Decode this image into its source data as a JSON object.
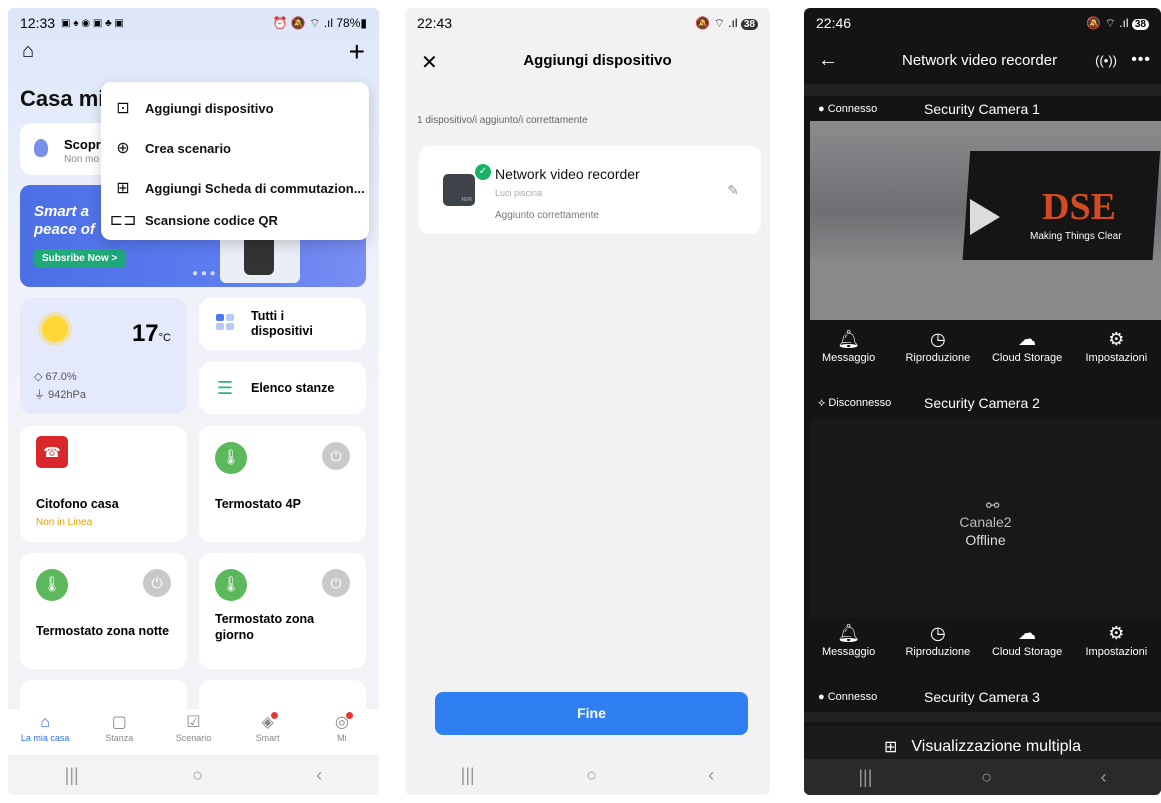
{
  "phone1": {
    "status": {
      "time": "12:33",
      "icons_left": "▣ ♠ ◉ ▣ ♣ ▣",
      "right": "⏰ 🔕 ⌔ .ıl 78%▮"
    },
    "home_title": "Casa mi",
    "discover": {
      "title": "Scopr",
      "subtitle": "Non mo"
    },
    "banner": {
      "line1": "Smart a",
      "line2": "peace of",
      "button": "Subsribe Now >"
    },
    "menu": [
      {
        "icon": "add-device-icon",
        "glyph": "⊡",
        "label": "Aggiungi dispositivo"
      },
      {
        "icon": "create-scene-icon",
        "glyph": "⊕",
        "label": "Crea scenario"
      },
      {
        "icon": "add-switch-icon",
        "glyph": "⊞",
        "label": "Aggiungi Scheda di commutazion..."
      },
      {
        "icon": "qr-scan-icon",
        "glyph": "⊏⊐",
        "label": "Scansione codice QR"
      }
    ],
    "weather": {
      "temp": "17",
      "unit": "°C",
      "humidity": "◇ 67.0%",
      "pressure": "⏚ 942hPa"
    },
    "quick": {
      "all_devices": "Tutti i dispositivi",
      "rooms": "Elenco stanze"
    },
    "devices": [
      {
        "name": "Citofono casa",
        "status": "Non in Linea"
      },
      {
        "name": "Termostato 4P"
      },
      {
        "name": "Termostato zona notte"
      },
      {
        "name": "Termostato zona giorno"
      }
    ],
    "tabs": [
      {
        "label": "La mia casa",
        "icon": "home-icon",
        "glyph": "⌂"
      },
      {
        "label": "Stanza",
        "icon": "room-icon",
        "glyph": "▢"
      },
      {
        "label": "Scenario",
        "icon": "scenario-icon",
        "glyph": "☑"
      },
      {
        "label": "Smart",
        "icon": "smart-icon",
        "glyph": "◈"
      },
      {
        "label": "Mi",
        "icon": "profile-icon",
        "glyph": "◎"
      }
    ]
  },
  "phone2": {
    "status": {
      "time": "22:43",
      "right": "🔕 ⌔ .ıl",
      "battery": "38"
    },
    "title": "Aggiungi dispositivo",
    "subtitle": "1 dispositivo/i aggiunto/i correttamente",
    "device": {
      "name": "Network video recorder",
      "room": "Luci piscina",
      "status": "Aggiunto correttamente",
      "badge": "NVR"
    },
    "done_button": "Fine"
  },
  "phone3": {
    "status": {
      "time": "22:46",
      "right": "🔕 ⌔ .ıl",
      "battery": "38"
    },
    "title": "Network video recorder",
    "cameras": [
      {
        "status": "● Connesso",
        "name": "Security Camera  1"
      },
      {
        "status": "⟡ Disconnesso",
        "name": "Security Camera  2",
        "channel": "Canale2",
        "offline": "Offline"
      },
      {
        "status": "● Connesso",
        "name": "Security Camera  3"
      }
    ],
    "feed_brand": "DSE",
    "feed_tagline": "Making Things Clear",
    "actions": [
      "Messaggio",
      "Riproduzione",
      "Cloud Storage",
      "Impostazioni"
    ],
    "multi_view": "Visualizzazione multipla"
  },
  "colors": {
    "accent": "#2f7ff2",
    "success": "#19b26b",
    "warning": "#e0a100",
    "intercom": "#d8262b",
    "thermostat": "#5cb85c"
  }
}
